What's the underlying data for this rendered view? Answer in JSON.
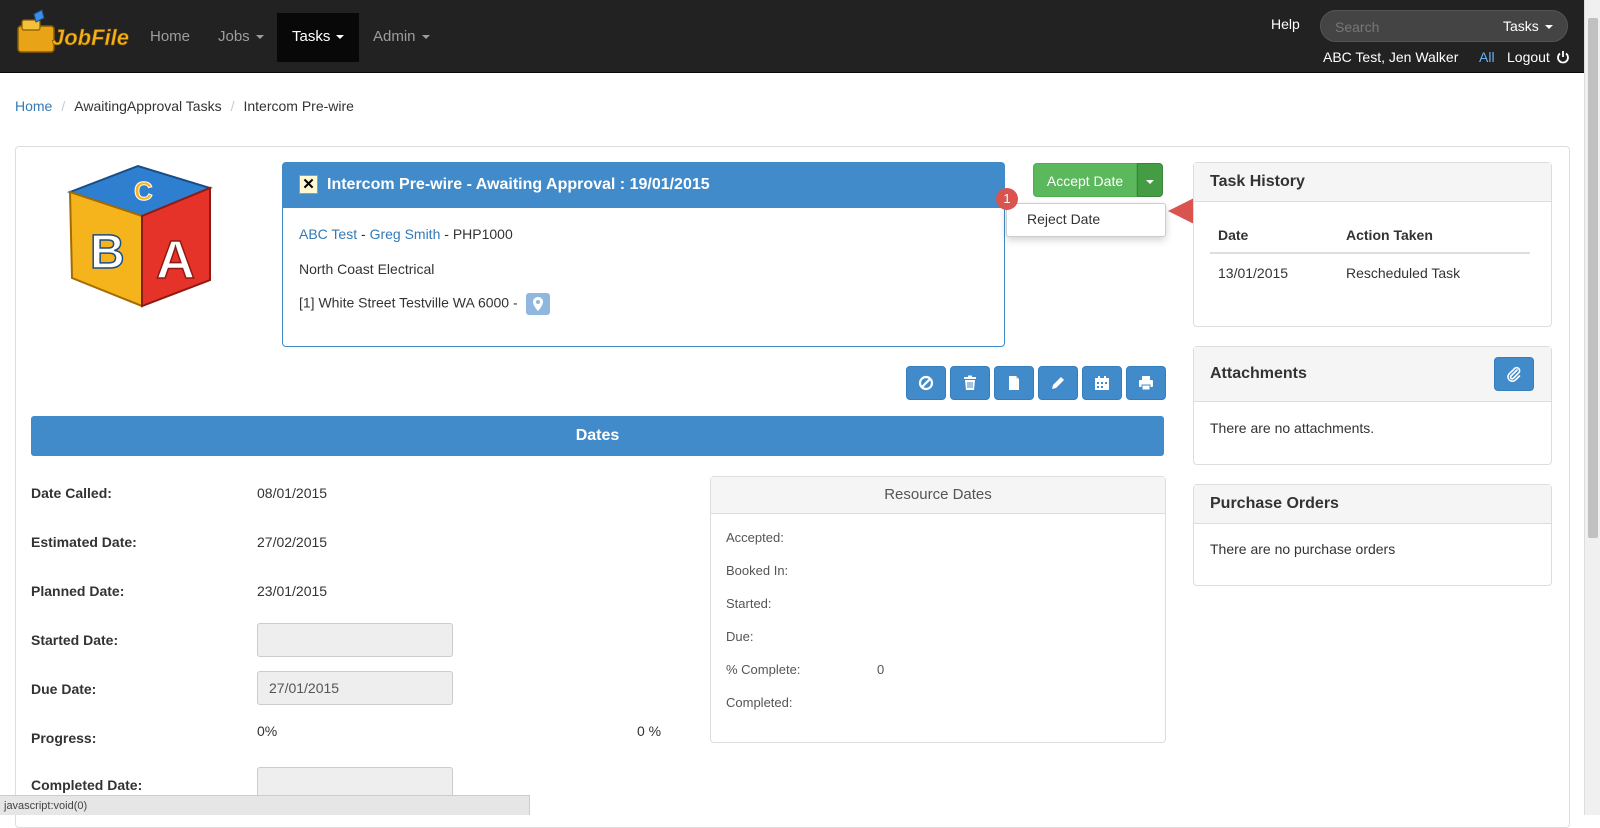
{
  "app": {
    "name": "JobFile"
  },
  "nav": {
    "items": [
      {
        "label": "Home"
      },
      {
        "label": "Jobs"
      },
      {
        "label": "Tasks"
      },
      {
        "label": "Admin"
      }
    ],
    "help": "Help",
    "search_placeholder": "Search",
    "search_scope": "Tasks",
    "user": "ABC Test, Jen Walker",
    "all": "All",
    "logout": "Logout"
  },
  "breadcrumb": [
    "Home",
    "AwaitingApproval Tasks",
    "Intercom Pre-wire"
  ],
  "task": {
    "title": "Intercom Pre-wire - Awaiting Approval : 19/01/2015",
    "client": "ABC Test",
    "sep1": " - ",
    "contact": "Greg Smith",
    "sep2": " - ",
    "code": "PHP1000",
    "company": "North Coast Electrical",
    "address": "[1] White Street Testville WA 6000 -"
  },
  "actions": {
    "accept": "Accept Date",
    "reject": "Reject Date",
    "callout_number": "1"
  },
  "dates": {
    "header": "Dates",
    "rows": [
      {
        "label": "Date Called:",
        "value": "08/01/2015"
      },
      {
        "label": "Estimated Date:",
        "value": "27/02/2015"
      },
      {
        "label": "Planned Date:",
        "value": "23/01/2015"
      },
      {
        "label": "Started Date:",
        "value": ""
      },
      {
        "label": "Due Date:",
        "value": "27/01/2015"
      },
      {
        "label": "Progress:",
        "value": "0%"
      },
      {
        "label": "Completed Date:",
        "value": ""
      }
    ],
    "progress_right": "0 %"
  },
  "resource": {
    "header": "Resource Dates",
    "rows": [
      {
        "label": "Accepted:",
        "value": ""
      },
      {
        "label": "Booked In:",
        "value": ""
      },
      {
        "label": "Started:",
        "value": ""
      },
      {
        "label": "Due:",
        "value": ""
      },
      {
        "label": "% Complete:",
        "value": "0"
      },
      {
        "label": "Completed:",
        "value": ""
      }
    ]
  },
  "history": {
    "title": "Task History",
    "columns": [
      "Date",
      "Action Taken"
    ],
    "rows": [
      {
        "date": "13/01/2015",
        "action": "Rescheduled Task"
      }
    ]
  },
  "attachments": {
    "title": "Attachments",
    "empty": "There are no attachments."
  },
  "purchase_orders": {
    "title": "Purchase Orders",
    "empty": "There are no purchase orders"
  },
  "status_bar": "javascript:void(0)",
  "colors": {
    "primary": "#428bca",
    "success": "#5cb85c",
    "navbar": "#222222",
    "danger": "#d9534f"
  }
}
